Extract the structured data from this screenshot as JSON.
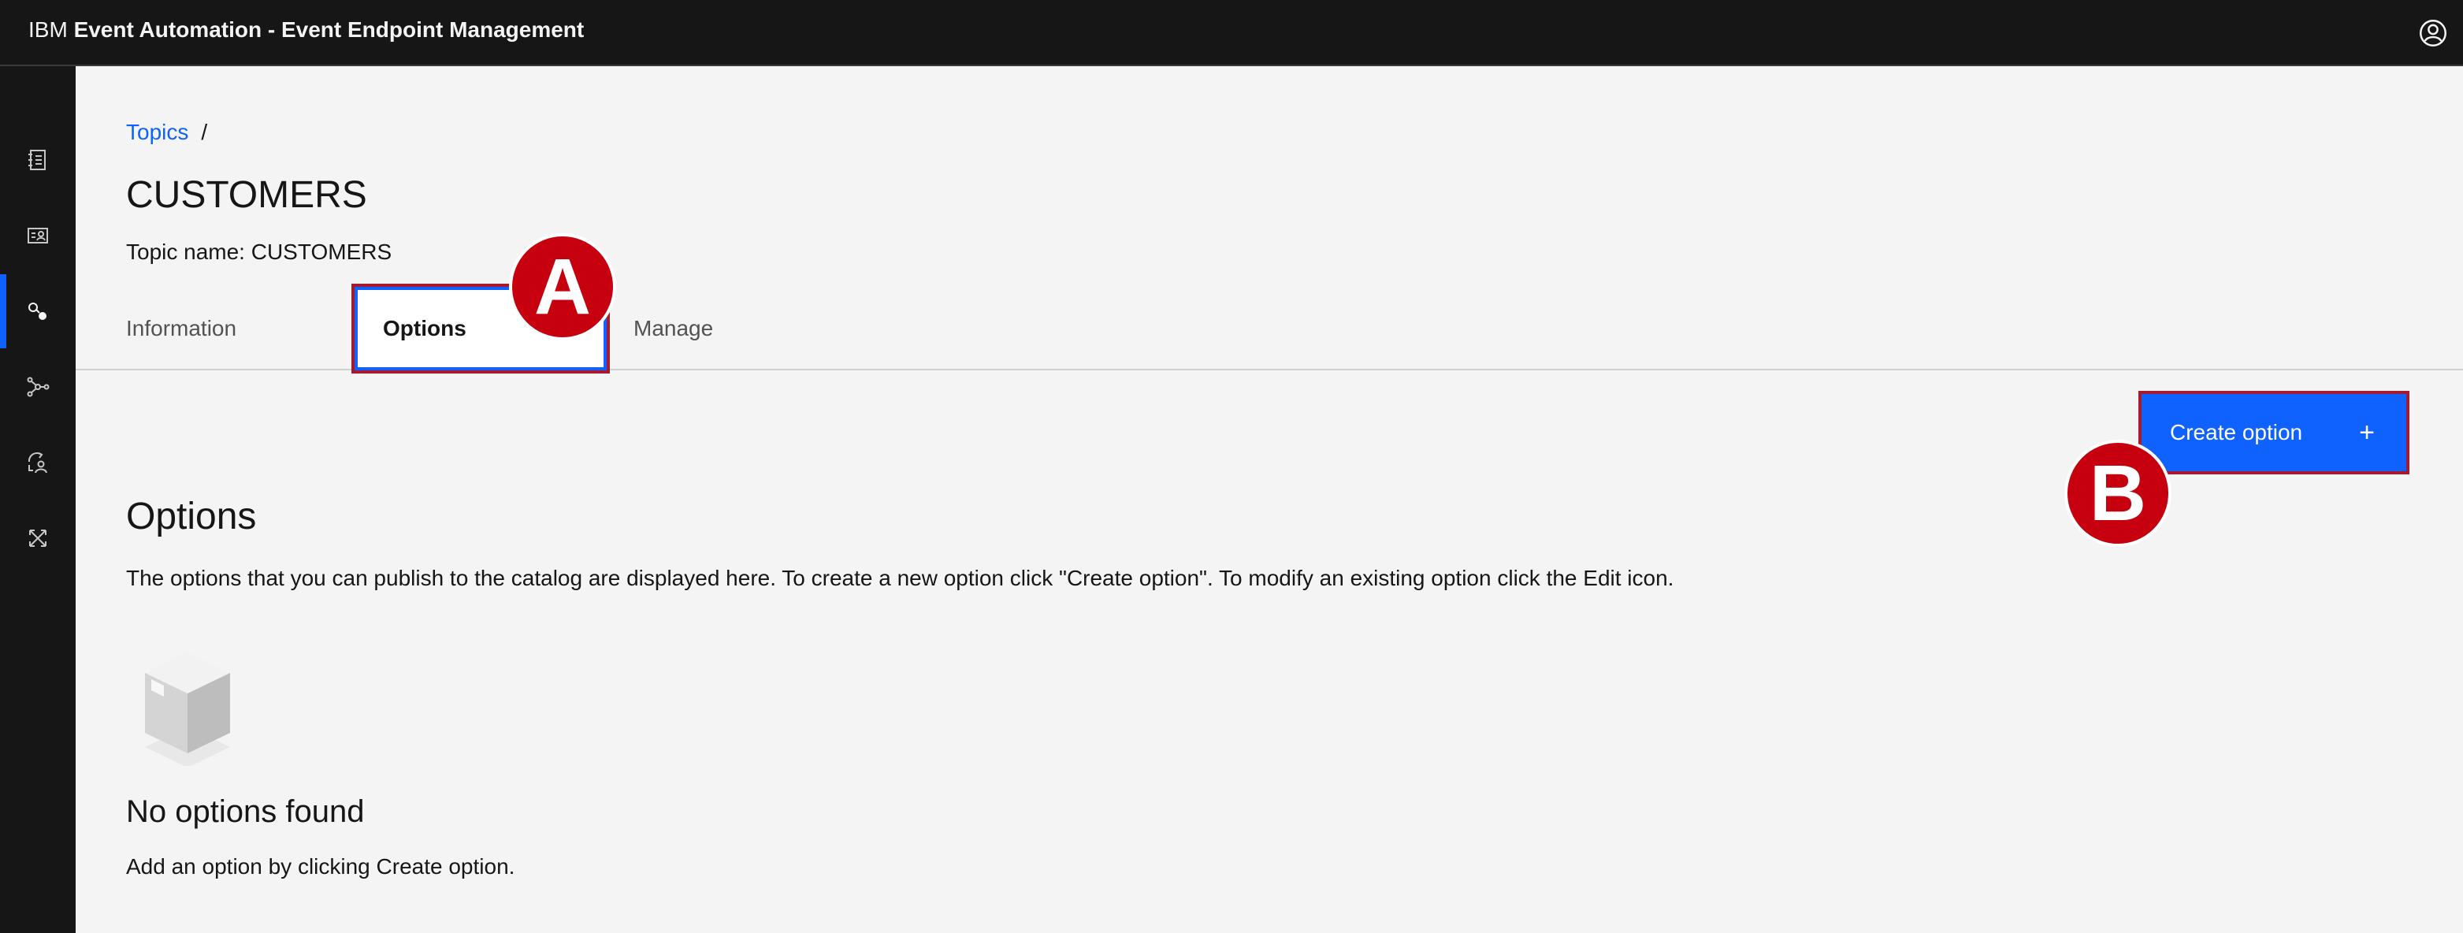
{
  "header": {
    "brand_prefix": "IBM",
    "product_name": "Event Automation - Event Endpoint Management",
    "user_icon": "user-avatar-icon"
  },
  "sidenav": {
    "items": [
      {
        "icon": "catalog-icon",
        "active": false
      },
      {
        "icon": "subscriptions-icon",
        "active": false
      },
      {
        "icon": "topics-icon",
        "active": true
      },
      {
        "icon": "gateways-icon",
        "active": false
      },
      {
        "icon": "user-management-icon",
        "active": false
      },
      {
        "icon": "integrations-icon",
        "active": false
      }
    ]
  },
  "breadcrumb": {
    "link": "Topics",
    "separator": "/"
  },
  "page": {
    "title": "CUSTOMERS",
    "topic_name": "Topic name: CUSTOMERS"
  },
  "tabs": [
    {
      "label": "Information",
      "selected": false
    },
    {
      "label": "Options",
      "selected": true
    },
    {
      "label": "Manage",
      "selected": false
    }
  ],
  "toolbar": {
    "create_label": "Create option",
    "create_icon": "+"
  },
  "options_section": {
    "title": "Options",
    "description": "The options that you can publish to the catalog are displayed here. To create a new option click \"Create option\". To modify an existing option click the Edit icon."
  },
  "empty_state": {
    "icon": "empty-box-icon",
    "title": "No options found",
    "description": "Add an option by clicking Create option."
  },
  "markers": {
    "a": "A",
    "b": "B"
  },
  "colors": {
    "accent": "#0f62fe",
    "header_bg": "#161616",
    "page_bg": "#f4f4f4",
    "marker": "#c6000f",
    "highlight_border": "#a61a2e"
  }
}
